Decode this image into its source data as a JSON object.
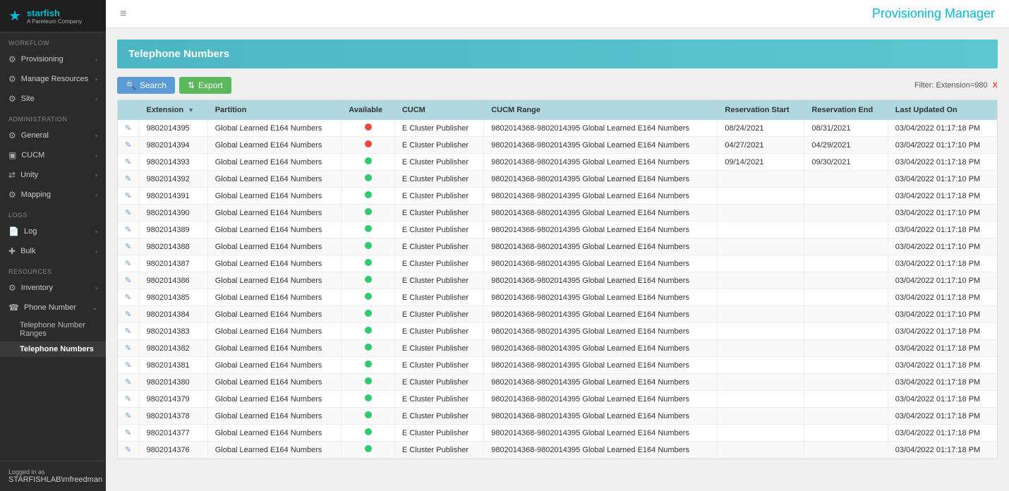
{
  "app": {
    "title": "Provisioning Manager",
    "logo_text": "starfish",
    "logo_sub": "A Pareteum Company"
  },
  "sidebar": {
    "menu_icon": "≡",
    "sections": [
      {
        "label": "WORKFLOW",
        "items": [
          {
            "id": "provisioning",
            "label": "Provisioning",
            "icon": "⚙",
            "has_sub": true
          },
          {
            "id": "manage-resources",
            "label": "Manage Resources",
            "icon": "⚙",
            "has_sub": true
          },
          {
            "id": "site",
            "label": "Site",
            "icon": "⚙",
            "has_sub": true
          }
        ]
      },
      {
        "label": "ADMINISTRATION",
        "items": [
          {
            "id": "general",
            "label": "General",
            "icon": "⚙",
            "has_sub": true
          },
          {
            "id": "cucm",
            "label": "CUCM",
            "icon": "▣",
            "has_sub": true
          },
          {
            "id": "unity",
            "label": "Unity",
            "icon": "⇄",
            "has_sub": true
          },
          {
            "id": "mapping",
            "label": "Mapping",
            "icon": "⚙",
            "has_sub": true
          }
        ]
      },
      {
        "label": "LOGS",
        "items": [
          {
            "id": "log",
            "label": "Log",
            "icon": "📄",
            "has_sub": true
          },
          {
            "id": "bulk",
            "label": "Bulk",
            "icon": "✚",
            "has_sub": true
          }
        ]
      },
      {
        "label": "RESOURCES",
        "items": [
          {
            "id": "inventory",
            "label": "Inventory",
            "icon": "⚙",
            "has_sub": true
          },
          {
            "id": "phone-number",
            "label": "Phone Number",
            "icon": "☎",
            "has_sub": true,
            "expanded": true
          }
        ]
      }
    ],
    "phone_number_sub": [
      {
        "id": "telephone-number-ranges",
        "label": "Telephone Number Ranges",
        "active": false
      },
      {
        "id": "telephone-numbers",
        "label": "Telephone Numbers",
        "active": true
      }
    ],
    "footer": {
      "logged_in_label": "Logged in as",
      "username": "STARFISHLAB\\mfreedman"
    }
  },
  "toolbar": {
    "search_label": "Search",
    "export_label": "Export",
    "filter_label": "Filter: Extension=980 X"
  },
  "page": {
    "title": "Telephone Numbers"
  },
  "table": {
    "columns": [
      {
        "id": "edit",
        "label": ""
      },
      {
        "id": "extension",
        "label": "Extension",
        "sortable": true
      },
      {
        "id": "partition",
        "label": "Partition"
      },
      {
        "id": "available",
        "label": "Available"
      },
      {
        "id": "cucm",
        "label": "CUCM"
      },
      {
        "id": "cucm_range",
        "label": "CUCM Range"
      },
      {
        "id": "reservation_start",
        "label": "Reservation Start"
      },
      {
        "id": "reservation_end",
        "label": "Reservation End"
      },
      {
        "id": "last_updated_on",
        "label": "Last Updated On"
      }
    ],
    "rows": [
      {
        "extension": "9802014395",
        "partition": "Global Learned E164 Numbers",
        "available": "red",
        "cucm": "E Cluster Publisher",
        "cucm_range": "9802014368-9802014395 Global Learned E164 Numbers",
        "reservation_start": "08/24/2021",
        "reservation_end": "08/31/2021",
        "last_updated": "03/04/2022 01:17:18 PM"
      },
      {
        "extension": "9802014394",
        "partition": "Global Learned E164 Numbers",
        "available": "red",
        "cucm": "E Cluster Publisher",
        "cucm_range": "9802014368-9802014395 Global Learned E164 Numbers",
        "reservation_start": "04/27/2021",
        "reservation_end": "04/29/2021",
        "last_updated": "03/04/2022 01:17:10 PM"
      },
      {
        "extension": "9802014393",
        "partition": "Global Learned E164 Numbers",
        "available": "green",
        "cucm": "E Cluster Publisher",
        "cucm_range": "9802014368-9802014395 Global Learned E164 Numbers",
        "reservation_start": "09/14/2021",
        "reservation_end": "09/30/2021",
        "last_updated": "03/04/2022 01:17:18 PM"
      },
      {
        "extension": "9802014392",
        "partition": "Global Learned E164 Numbers",
        "available": "green",
        "cucm": "E Cluster Publisher",
        "cucm_range": "9802014368-9802014395 Global Learned E164 Numbers",
        "reservation_start": "",
        "reservation_end": "",
        "last_updated": "03/04/2022 01:17:10 PM"
      },
      {
        "extension": "9802014391",
        "partition": "Global Learned E164 Numbers",
        "available": "green",
        "cucm": "E Cluster Publisher",
        "cucm_range": "9802014368-9802014395 Global Learned E164 Numbers",
        "reservation_start": "",
        "reservation_end": "",
        "last_updated": "03/04/2022 01:17:18 PM"
      },
      {
        "extension": "9802014390",
        "partition": "Global Learned E164 Numbers",
        "available": "green",
        "cucm": "E Cluster Publisher",
        "cucm_range": "9802014368-9802014395 Global Learned E164 Numbers",
        "reservation_start": "",
        "reservation_end": "",
        "last_updated": "03/04/2022 01:17:10 PM"
      },
      {
        "extension": "9802014389",
        "partition": "Global Learned E164 Numbers",
        "available": "green",
        "cucm": "E Cluster Publisher",
        "cucm_range": "9802014368-9802014395 Global Learned E164 Numbers",
        "reservation_start": "",
        "reservation_end": "",
        "last_updated": "03/04/2022 01:17:18 PM"
      },
      {
        "extension": "9802014388",
        "partition": "Global Learned E164 Numbers",
        "available": "green",
        "cucm": "E Cluster Publisher",
        "cucm_range": "9802014368-9802014395 Global Learned E164 Numbers",
        "reservation_start": "",
        "reservation_end": "",
        "last_updated": "03/04/2022 01:17:10 PM"
      },
      {
        "extension": "9802014387",
        "partition": "Global Learned E164 Numbers",
        "available": "green",
        "cucm": "E Cluster Publisher",
        "cucm_range": "9802014368-9802014395 Global Learned E164 Numbers",
        "reservation_start": "",
        "reservation_end": "",
        "last_updated": "03/04/2022 01:17:18 PM"
      },
      {
        "extension": "9802014386",
        "partition": "Global Learned E164 Numbers",
        "available": "green",
        "cucm": "E Cluster Publisher",
        "cucm_range": "9802014368-9802014395 Global Learned E164 Numbers",
        "reservation_start": "",
        "reservation_end": "",
        "last_updated": "03/04/2022 01:17:10 PM"
      },
      {
        "extension": "9802014385",
        "partition": "Global Learned E164 Numbers",
        "available": "green",
        "cucm": "E Cluster Publisher",
        "cucm_range": "9802014368-9802014395 Global Learned E164 Numbers",
        "reservation_start": "",
        "reservation_end": "",
        "last_updated": "03/04/2022 01:17:18 PM"
      },
      {
        "extension": "9802014384",
        "partition": "Global Learned E164 Numbers",
        "available": "green",
        "cucm": "E Cluster Publisher",
        "cucm_range": "9802014368-9802014395 Global Learned E164 Numbers",
        "reservation_start": "",
        "reservation_end": "",
        "last_updated": "03/04/2022 01:17:10 PM"
      },
      {
        "extension": "9802014383",
        "partition": "Global Learned E164 Numbers",
        "available": "green",
        "cucm": "E Cluster Publisher",
        "cucm_range": "9802014368-9802014395 Global Learned E164 Numbers",
        "reservation_start": "",
        "reservation_end": "",
        "last_updated": "03/04/2022 01:17:18 PM"
      },
      {
        "extension": "9802014382",
        "partition": "Global Learned E164 Numbers",
        "available": "green",
        "cucm": "E Cluster Publisher",
        "cucm_range": "9802014368-9802014395 Global Learned E164 Numbers",
        "reservation_start": "",
        "reservation_end": "",
        "last_updated": "03/04/2022 01:17:18 PM"
      },
      {
        "extension": "9802014381",
        "partition": "Global Learned E164 Numbers",
        "available": "green",
        "cucm": "E Cluster Publisher",
        "cucm_range": "9802014368-9802014395 Global Learned E164 Numbers",
        "reservation_start": "",
        "reservation_end": "",
        "last_updated": "03/04/2022 01:17:18 PM"
      },
      {
        "extension": "9802014380",
        "partition": "Global Learned E164 Numbers",
        "available": "green",
        "cucm": "E Cluster Publisher",
        "cucm_range": "9802014368-9802014395 Global Learned E164 Numbers",
        "reservation_start": "",
        "reservation_end": "",
        "last_updated": "03/04/2022 01:17:18 PM"
      },
      {
        "extension": "9802014379",
        "partition": "Global Learned E164 Numbers",
        "available": "green",
        "cucm": "E Cluster Publisher",
        "cucm_range": "9802014368-9802014395 Global Learned E164 Numbers",
        "reservation_start": "",
        "reservation_end": "",
        "last_updated": "03/04/2022 01:17:18 PM"
      },
      {
        "extension": "9802014378",
        "partition": "Global Learned E164 Numbers",
        "available": "green",
        "cucm": "E Cluster Publisher",
        "cucm_range": "9802014368-9802014395 Global Learned E164 Numbers",
        "reservation_start": "",
        "reservation_end": "",
        "last_updated": "03/04/2022 01:17:18 PM"
      },
      {
        "extension": "9802014377",
        "partition": "Global Learned E164 Numbers",
        "available": "green",
        "cucm": "E Cluster Publisher",
        "cucm_range": "9802014368-9802014395 Global Learned E164 Numbers",
        "reservation_start": "",
        "reservation_end": "",
        "last_updated": "03/04/2022 01:17:18 PM"
      },
      {
        "extension": "9802014376",
        "partition": "Global Learned E164 Numbers",
        "available": "green",
        "cucm": "E Cluster Publisher",
        "cucm_range": "9802014368-9802014395 Global Learned E164 Numbers",
        "reservation_start": "",
        "reservation_end": "",
        "last_updated": "03/04/2022 01:17:18 PM"
      }
    ]
  },
  "scrollbar": {
    "visible": true
  }
}
